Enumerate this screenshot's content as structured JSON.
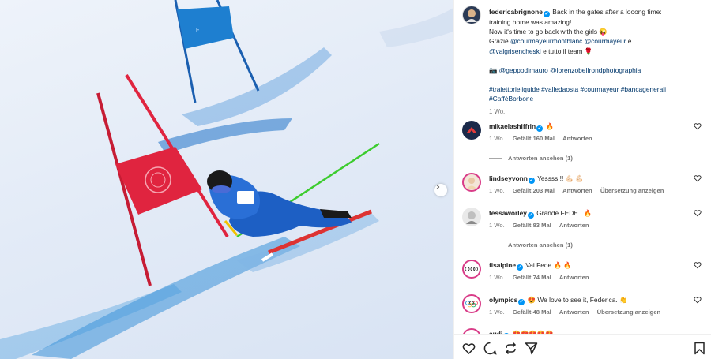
{
  "post": {
    "author": "federicabrignone",
    "caption_lines": [
      "Back in the gates after a looong time:",
      "training home was amazing!",
      "Now it's time to go back with the girls 😜",
      "Grazie"
    ],
    "caption_mentions_1": [
      "@courmayeurmontblanc",
      "@courmayeur"
    ],
    "caption_and": "e",
    "caption_mention_2": "@valgrisencheski",
    "caption_tail": "e tutto il team 🌹",
    "photo_credit_icon": "📷",
    "photo_credits": [
      "@geppodimauro",
      "@lorenzobelfrondphotographia"
    ],
    "hashtags_line_1": [
      "#traiettorieliquide",
      "#valledaosta",
      "#courmayeur",
      "#bancagenerali"
    ],
    "hashtags_line_2": [
      "#CaffèBorbone"
    ],
    "time_ago": "1 Wo."
  },
  "comments": [
    {
      "user": "mikaelashiffrin",
      "text": "🔥",
      "time": "1 Wo.",
      "likes": "Gefällt 160 Mal",
      "reply": "Antworten",
      "view_replies": "Antworten ansehen (1)"
    },
    {
      "user": "lindseyvonn",
      "text": "Yessss!!! 💪🏻 💪🏻",
      "time": "1 Wo.",
      "likes": "Gefällt 203 Mal",
      "reply": "Antworten",
      "translate": "Übersetzung anzeigen"
    },
    {
      "user": "tessaworley",
      "text": "Grande FEDE ! 🔥",
      "time": "1 Wo.",
      "likes": "Gefällt 83 Mal",
      "reply": "Antworten",
      "view_replies": "Antworten ansehen (1)"
    },
    {
      "user": "fisalpine",
      "text": "Vai Fede 🔥 🔥",
      "time": "1 Wo.",
      "likes": "Gefällt 74 Mal",
      "reply": "Antworten"
    },
    {
      "user": "olympics",
      "text": "😍 We love to see it, Federica. 👏",
      "time": "1 Wo.",
      "likes": "Gefällt 48 Mal",
      "reply": "Antworten",
      "translate": "Übersetzung anzeigen"
    },
    {
      "user": "audi",
      "text": "😍😍😍😍😍"
    }
  ],
  "colors": {
    "verified": "#0095f6",
    "link": "#00376b",
    "gate_red": "#e0243f",
    "gate_blue": "#1e7fd0",
    "pole_green": "#3ccc2e"
  },
  "icons": {
    "next": "chevron-right-icon",
    "like": "heart-icon",
    "comment": "comment-icon",
    "share": "share-icon",
    "send": "send-icon",
    "save": "bookmark-icon"
  }
}
